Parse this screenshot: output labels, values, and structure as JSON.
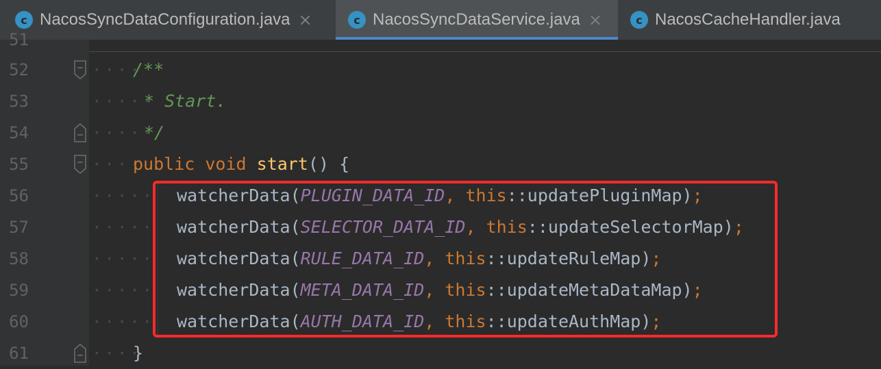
{
  "tabs": [
    {
      "icon": "c",
      "label": "NacosSyncDataConfiguration.java",
      "close": "×",
      "active": false
    },
    {
      "icon": "c",
      "label": "NacosSyncDataService.java",
      "close": "×",
      "active": true
    },
    {
      "icon": "c",
      "label": "NacosCacheHandler.java",
      "close": "",
      "active": false
    }
  ],
  "editor": {
    "lines": [
      {
        "num": "51"
      },
      {
        "num": "52",
        "comment": "/**"
      },
      {
        "num": "53",
        "comment": "* Start."
      },
      {
        "num": "54",
        "comment": "*/"
      },
      {
        "num": "55",
        "kw1": "public",
        "kw2": "void",
        "fn": "start",
        "rest": "() {"
      },
      {
        "num": "56",
        "call": "watcherData(",
        "const": "PLUGIN_DATA_ID",
        "comma": ",",
        "this": "this",
        "ref": "::updatePluginMap)",
        "semi": ";"
      },
      {
        "num": "57",
        "call": "watcherData(",
        "const": "SELECTOR_DATA_ID",
        "comma": ",",
        "this": "this",
        "ref": "::updateSelectorMap)",
        "semi": ";"
      },
      {
        "num": "58",
        "call": "watcherData(",
        "const": "RULE_DATA_ID",
        "comma": ",",
        "this": "this",
        "ref": "::updateRuleMap)",
        "semi": ";"
      },
      {
        "num": "59",
        "call": "watcherData(",
        "const": "META_DATA_ID",
        "comma": ",",
        "this": "this",
        "ref": "::updateMetaDataMap)",
        "semi": ";"
      },
      {
        "num": "60",
        "call": "watcherData(",
        "const": "AUTH_DATA_ID",
        "comma": ",",
        "this": "this",
        "ref": "::updateAuthMap)",
        "semi": ";"
      },
      {
        "num": "61",
        "brace": "}"
      }
    ]
  },
  "colors": {
    "tab_icon": "#3592c4",
    "highlight_box": "#ff2a2a",
    "keyword": "#cc7832",
    "comment": "#629755",
    "constant": "#9876aa",
    "function": "#ffc66d"
  }
}
